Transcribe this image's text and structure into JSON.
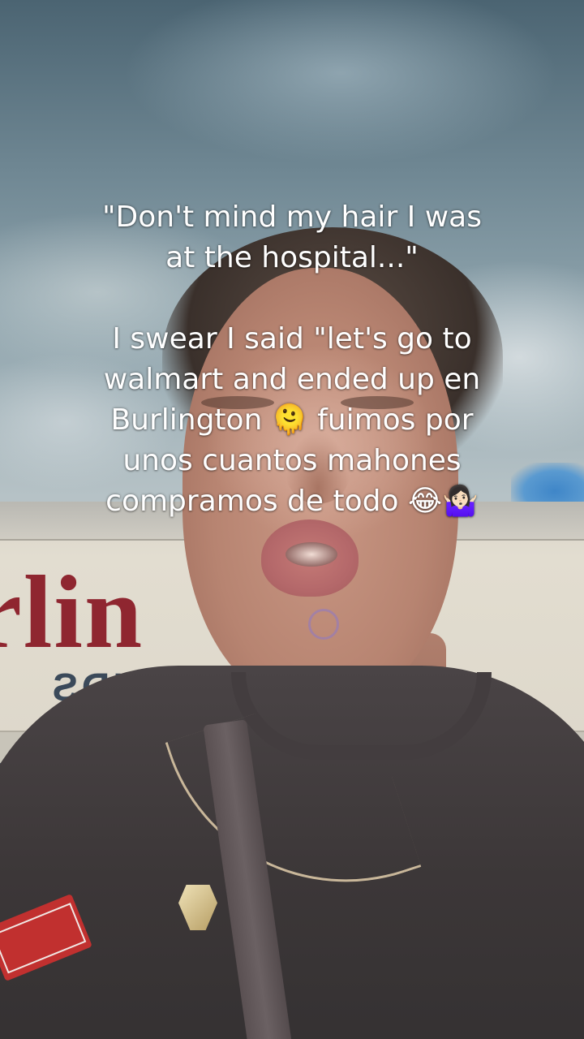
{
  "scene": {
    "description_type": "selfie video frame",
    "sign": {
      "main_text": "rlin",
      "sub_text": "BRANDS"
    }
  },
  "caption": {
    "line1": "\"Don't mind my hair I was",
    "line2": "at the hospital...\"",
    "line3": "I swear I said \"let's go to",
    "line4": "walmart and ended up en",
    "line5": "Burlington 🫠 fuimos por",
    "line6": "unos cuantos mahones",
    "line7": "compramos de todo 😂🤷🏻‍♀️"
  }
}
